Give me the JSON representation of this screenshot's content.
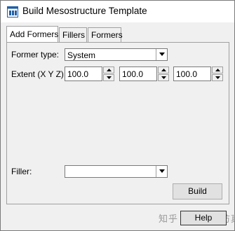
{
  "window": {
    "title": "Build Mesostructure Template",
    "icon": "app-window-icon"
  },
  "tabs": [
    {
      "label": "Add Formers",
      "active": true
    },
    {
      "label": "Fillers",
      "active": false
    },
    {
      "label": "Formers",
      "active": false
    }
  ],
  "form": {
    "former_type_label": "Former type:",
    "former_type_value": "System",
    "extent_label": "Extent (X Y Z):",
    "extent_x": "100.0",
    "extent_y": "100.0",
    "extent_z": "100.0",
    "filler_label": "Filler:",
    "filler_value": ""
  },
  "buttons": {
    "build": "Build",
    "help": "Help"
  },
  "watermark": {
    "text": "知乎 @万图云仿真"
  }
}
